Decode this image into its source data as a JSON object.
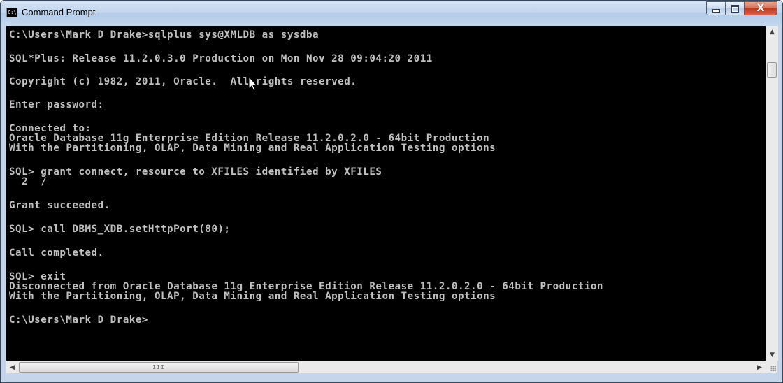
{
  "window": {
    "title": "Command Prompt",
    "icon_label": "C:\\.",
    "minimize_icon": "minimize-icon",
    "maximize_icon": "maximize-icon",
    "close_icon": "close-icon",
    "close_glyph": "X"
  },
  "console": {
    "lines": [
      "C:\\Users\\Mark D Drake>sqlplus sys@XMLDB as sysdba",
      "SQL*Plus: Release 11.2.0.3.0 Production on Mon Nov 28 09:04:20 2011",
      "Copyright (c) 1982, 2011, Oracle.  All rights reserved.",
      "Enter password:",
      "Connected to:",
      "Oracle Database 11g Enterprise Edition Release 11.2.0.2.0 - 64bit Production",
      "With the Partitioning, OLAP, Data Mining and Real Application Testing options",
      "SQL> grant connect, resource to XFILES identified by XFILES",
      "  2  /",
      "Grant succeeded.",
      "SQL> call DBMS_XDB.setHttpPort(80);",
      "Call completed.",
      "SQL> exit",
      "Disconnected from Oracle Database 11g Enterprise Edition Release 11.2.0.2.0 - 64bit Production",
      "With the Partitioning, OLAP, Data Mining and Real Application Testing options",
      "C:\\Users\\Mark D Drake>"
    ],
    "foreground": "#c0c0c0",
    "background": "#000000"
  },
  "scrollbars": {
    "up_arrow": "▲",
    "down_arrow": "▼",
    "left_arrow": "◀",
    "right_arrow": "▶",
    "hthumb_grip": "III"
  },
  "colors": {
    "titlebar": "#c2d6ee",
    "close_button": "#c2391a"
  }
}
